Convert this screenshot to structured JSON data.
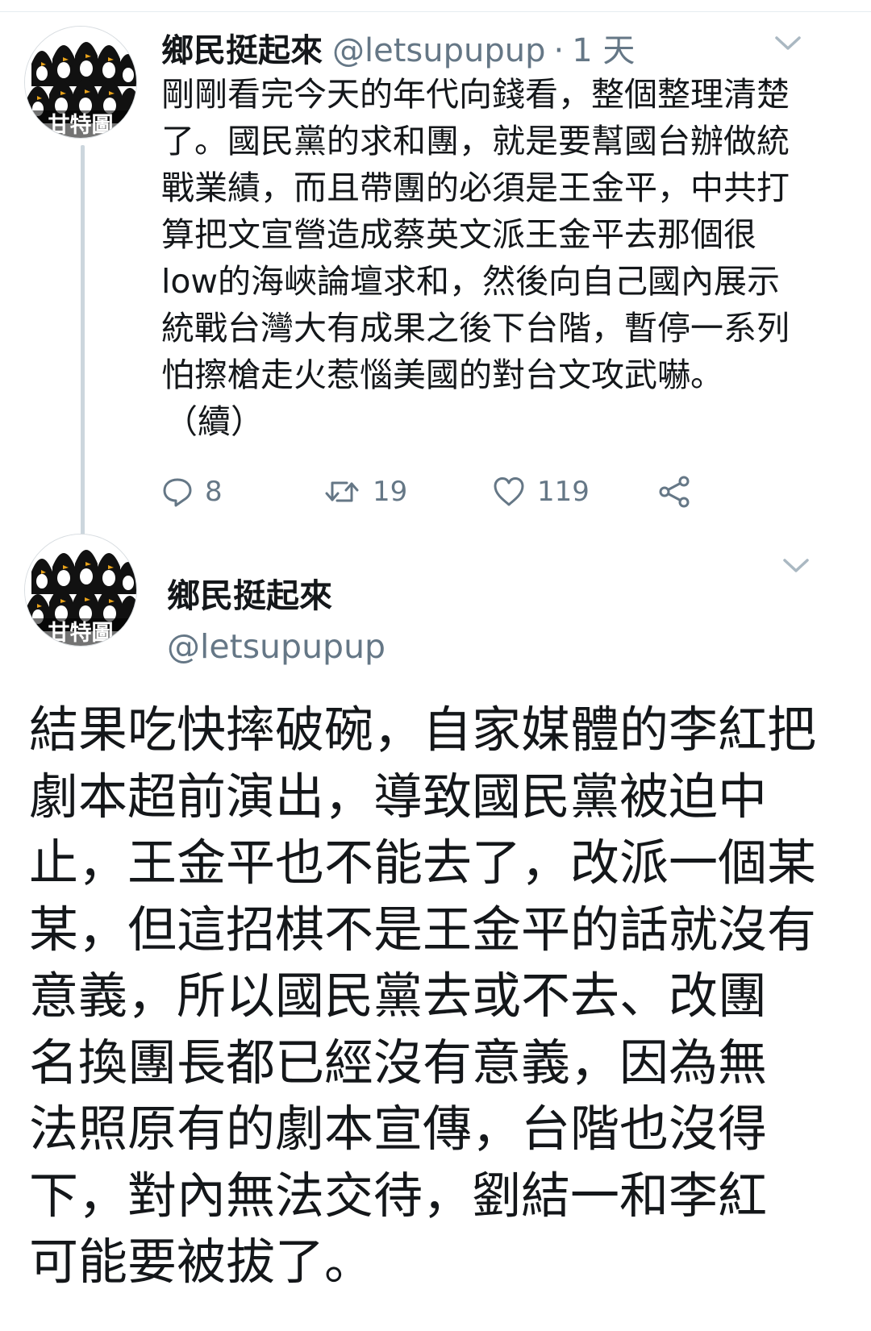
{
  "tweets": [
    {
      "display_name": "鄉民挺起來",
      "handle": "@letsupupup",
      "separator": "·",
      "timestamp": "1 天",
      "avatar": {
        "caption": "甘特圖",
        "icon": "penguin-crowd-avatar"
      },
      "lines": [
        "剛剛看完今天的年代向錢看，整個整理清楚",
        "了。國民黨的求和團，就是要幫國台辦做統",
        "戰業績，而且帶團的必須是王金平，中共打",
        "算把文宣營造成蔡英文派王金平去那個很",
        "low的海峽論壇求和，然後向自己國內展示",
        "統戰台灣大有成果之後下台階，暫停一系列",
        "怕擦槍走火惹惱美國的對台文攻武嚇。",
        "（續）"
      ],
      "actions": {
        "reply": {
          "icon": "reply-icon",
          "count": "8"
        },
        "retweet": {
          "icon": "retweet-icon",
          "count": "19"
        },
        "like": {
          "icon": "heart-icon",
          "count": "119"
        },
        "share": {
          "icon": "share-icon"
        }
      },
      "menu_icon": "chevron-down-icon"
    },
    {
      "display_name": "鄉民挺起來",
      "handle": "@letsupupup",
      "avatar": {
        "caption": "甘特圖",
        "icon": "penguin-crowd-avatar"
      },
      "lines": [
        "結果吃快摔破碗，自家媒體的李紅把",
        "劇本超前演出，導致國民黨被迫中",
        "止，王金平也不能去了，改派一個某",
        "某，但這招棋不是王金平的話就沒有",
        "意義，所以國民黨去或不去、改團",
        "名換團長都已經沒有意義，因為無",
        "法照原有的劇本宣傳，台階也沒得",
        "下，對內無法交待，劉結一和李紅",
        "可能要被拔了。"
      ],
      "menu_icon": "chevron-down-icon"
    }
  ],
  "colors": {
    "text_primary": "#14171a",
    "text_secondary": "#657786",
    "thread_line": "#ccd6dd"
  }
}
